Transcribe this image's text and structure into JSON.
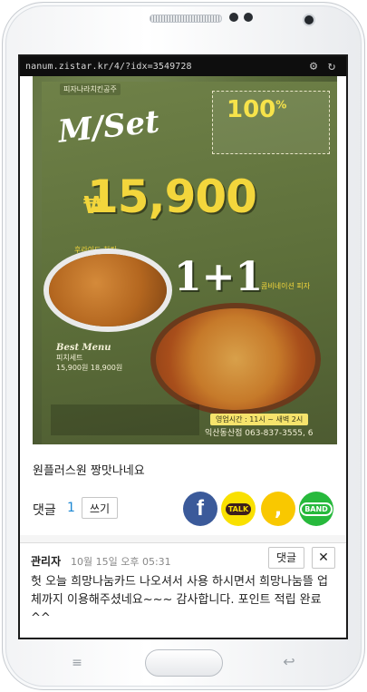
{
  "browser": {
    "url": "nanum.zistar.kr/4/?idx=3549728",
    "settings_icon": "gear-icon",
    "reload_icon": "reload-icon"
  },
  "ad_image": {
    "brand": "피자나라치킨공주",
    "title": "M/Set",
    "badge_percent": "100",
    "badge_unit": "%",
    "price_symbol": "₩",
    "price": "15,900",
    "promo": "1+1",
    "item_left_label": "후라이드 치킨",
    "item_right_label": "콤비네이션 피자",
    "menu_title": "Best Menu",
    "menu_sub": "피치세트",
    "menu_prices": "15,900원  18,900원",
    "hours": "영업시간 : 11시 ~ 새벽 2시",
    "address": "익산동산점 063-837-3555, 6"
  },
  "post": {
    "text": "원플러스원    짱맛나네요"
  },
  "comments_bar": {
    "label": "댓글",
    "count": "1",
    "write_label": "쓰기",
    "share": {
      "facebook": "f",
      "kakaotalk": "TALK",
      "kakaostory": ",",
      "band": "BAND"
    }
  },
  "comment": {
    "author": "관리자",
    "time": "10월 15일 오후 05:31",
    "reply_label": "댓글",
    "close_label": "✕",
    "body": "헛 오늘 희망나눔카드 나오셔서 사용 하시면서 희망나눔뜰 업체까지 이용해주셨네요~~~ 감사합니다. 포인트 적립 완료^^"
  },
  "device": {
    "menu_key": "≡",
    "back_key": "↩"
  },
  "colors": {
    "link_blue": "#1b87d3",
    "facebook": "#3b5a9a",
    "kakao_yellow": "#f9e000",
    "band_green": "#27b93c"
  }
}
